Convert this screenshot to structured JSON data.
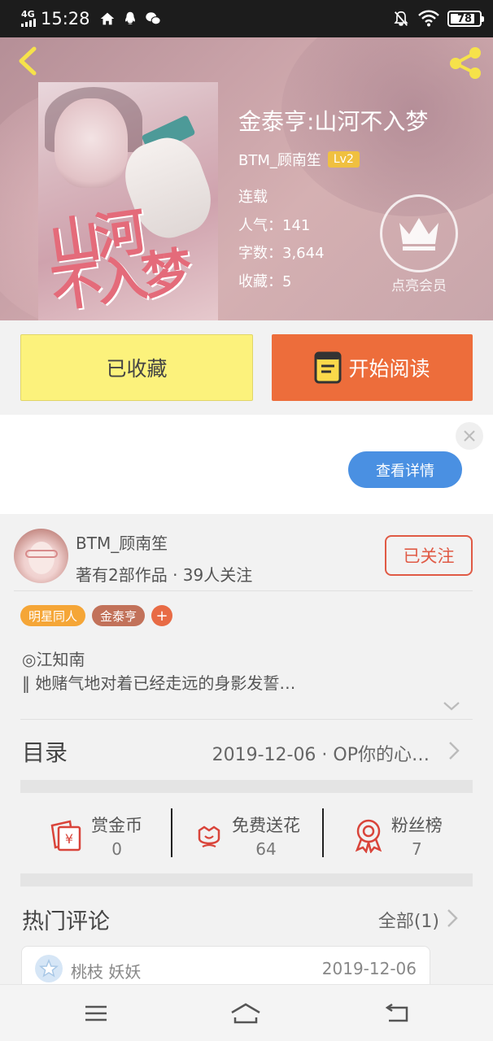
{
  "status_bar": {
    "network": "4G",
    "time": "15:28",
    "battery": "78"
  },
  "book": {
    "title": "金泰亨:山河不入梦",
    "author": "BTM_顾南笙",
    "author_level": "Lv2",
    "status": "连载",
    "popularity": "人气：141",
    "word_count": "字数：3,644",
    "favorites": "收藏：5",
    "vip_label": "点亮会员",
    "cover_art": [
      "山河",
      "不入梦"
    ]
  },
  "actions": {
    "favorited_label": "已收藏",
    "read_label": "开始阅读"
  },
  "ad": {
    "detail_label": "查看详情"
  },
  "author_card": {
    "name": "BTM_顾南笙",
    "info": "著有2部作品 · 39人关注",
    "follow_label": "已关注"
  },
  "tags": [
    {
      "label": "明星同人",
      "color": "#f5a637"
    },
    {
      "label": "金泰亨",
      "color": "#c2725a"
    }
  ],
  "tag_add": "+",
  "synopsis": {
    "line1": "◎江知南",
    "line2": "‖ 她赌气地对着已经走远的身影发誓…"
  },
  "toc": {
    "label": "目录",
    "latest": "2019-12-06 · OP你的心…"
  },
  "rewards": [
    {
      "label": "赏金币",
      "value": "0",
      "icon": "coin-envelope-icon"
    },
    {
      "label": "免费送花",
      "value": "64",
      "icon": "flower-icon"
    },
    {
      "label": "粉丝榜",
      "value": "7",
      "icon": "medal-icon"
    }
  ],
  "hot_comments": {
    "title": "热门评论",
    "all_label": "全部(1)"
  },
  "comment": {
    "user": "桃枝 妖妖",
    "date": "2019-12-06"
  },
  "colors": {
    "accent_orange": "#ed6d3b",
    "fav_yellow": "#fcf27c",
    "follow_red": "#e05a45",
    "detail_blue": "#4a90e2"
  }
}
